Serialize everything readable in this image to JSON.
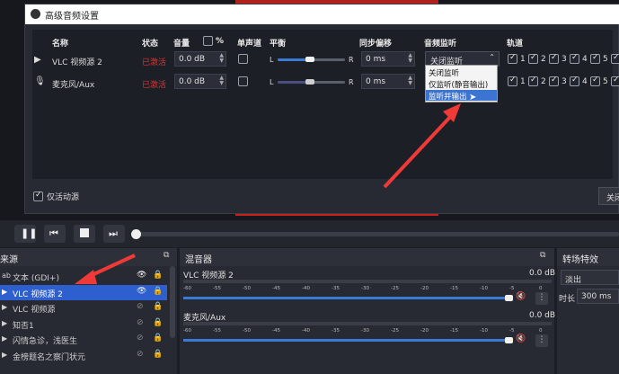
{
  "dialog": {
    "title": "高级音频设置",
    "columns": {
      "name": "名称",
      "status": "状态",
      "volume": "音量",
      "percent": "%",
      "mono": "单声道",
      "balance": "平衡",
      "sync_offset": "同步偏移",
      "monitoring": "音频监听",
      "tracks": "轨道"
    },
    "rows": [
      {
        "name": "VLC 视频源 2",
        "status": "已激活",
        "volume": "0.0 dB",
        "balance_left": "L",
        "balance_right": "R",
        "sync": "0 ms",
        "monitoring": "关闭监听",
        "tracks": [
          "1",
          "2",
          "3",
          "4",
          "5"
        ]
      },
      {
        "name": "麦克风/Aux",
        "status": "已激活",
        "volume": "0.0 dB",
        "balance_left": "L",
        "balance_right": "R",
        "sync": "0 ms",
        "monitoring": "",
        "tracks": [
          "1",
          "2",
          "3",
          "4",
          "5"
        ]
      }
    ],
    "monitor_options": [
      "关闭监听",
      "仅监听(静音输出)",
      "监听并输出"
    ],
    "monitor_selected": "监听并输出",
    "active_only_label": "仅活动源",
    "close_label": "关闭"
  },
  "sources": {
    "title": "来源",
    "items": [
      {
        "icon": "ab",
        "name": "文本 (GDI+)",
        "selected": false
      },
      {
        "icon": "▶",
        "name": "VLC 视频源 2",
        "selected": true
      },
      {
        "icon": "▶",
        "name": "VLC 视频源",
        "selected": false
      },
      {
        "icon": "▶",
        "name": "知否1",
        "selected": false
      },
      {
        "icon": "▶",
        "name": "闪情急诊，浅医生",
        "selected": false
      },
      {
        "icon": "▶",
        "name": "金榜题名之察门状元",
        "selected": false
      }
    ]
  },
  "mixer": {
    "title": "混音器",
    "channels": [
      {
        "name": "VLC 视频源 2",
        "db": "0.0 dB"
      },
      {
        "name": "麦克风/Aux",
        "db": "0.0 dB"
      }
    ],
    "ticks": [
      "-60",
      "-55",
      "-50",
      "-45",
      "-40",
      "-35",
      "-30",
      "-25",
      "-20",
      "-15",
      "-10",
      "-5",
      "0"
    ]
  },
  "transitions": {
    "title": "转场特效",
    "type": "淡出",
    "duration_label": "时长",
    "duration": "300 ms"
  },
  "colors": {
    "accent": "#3a7bd5",
    "status_red": "#e03030",
    "arrow": "#ef3a37",
    "selection": "#2d5fcf"
  }
}
